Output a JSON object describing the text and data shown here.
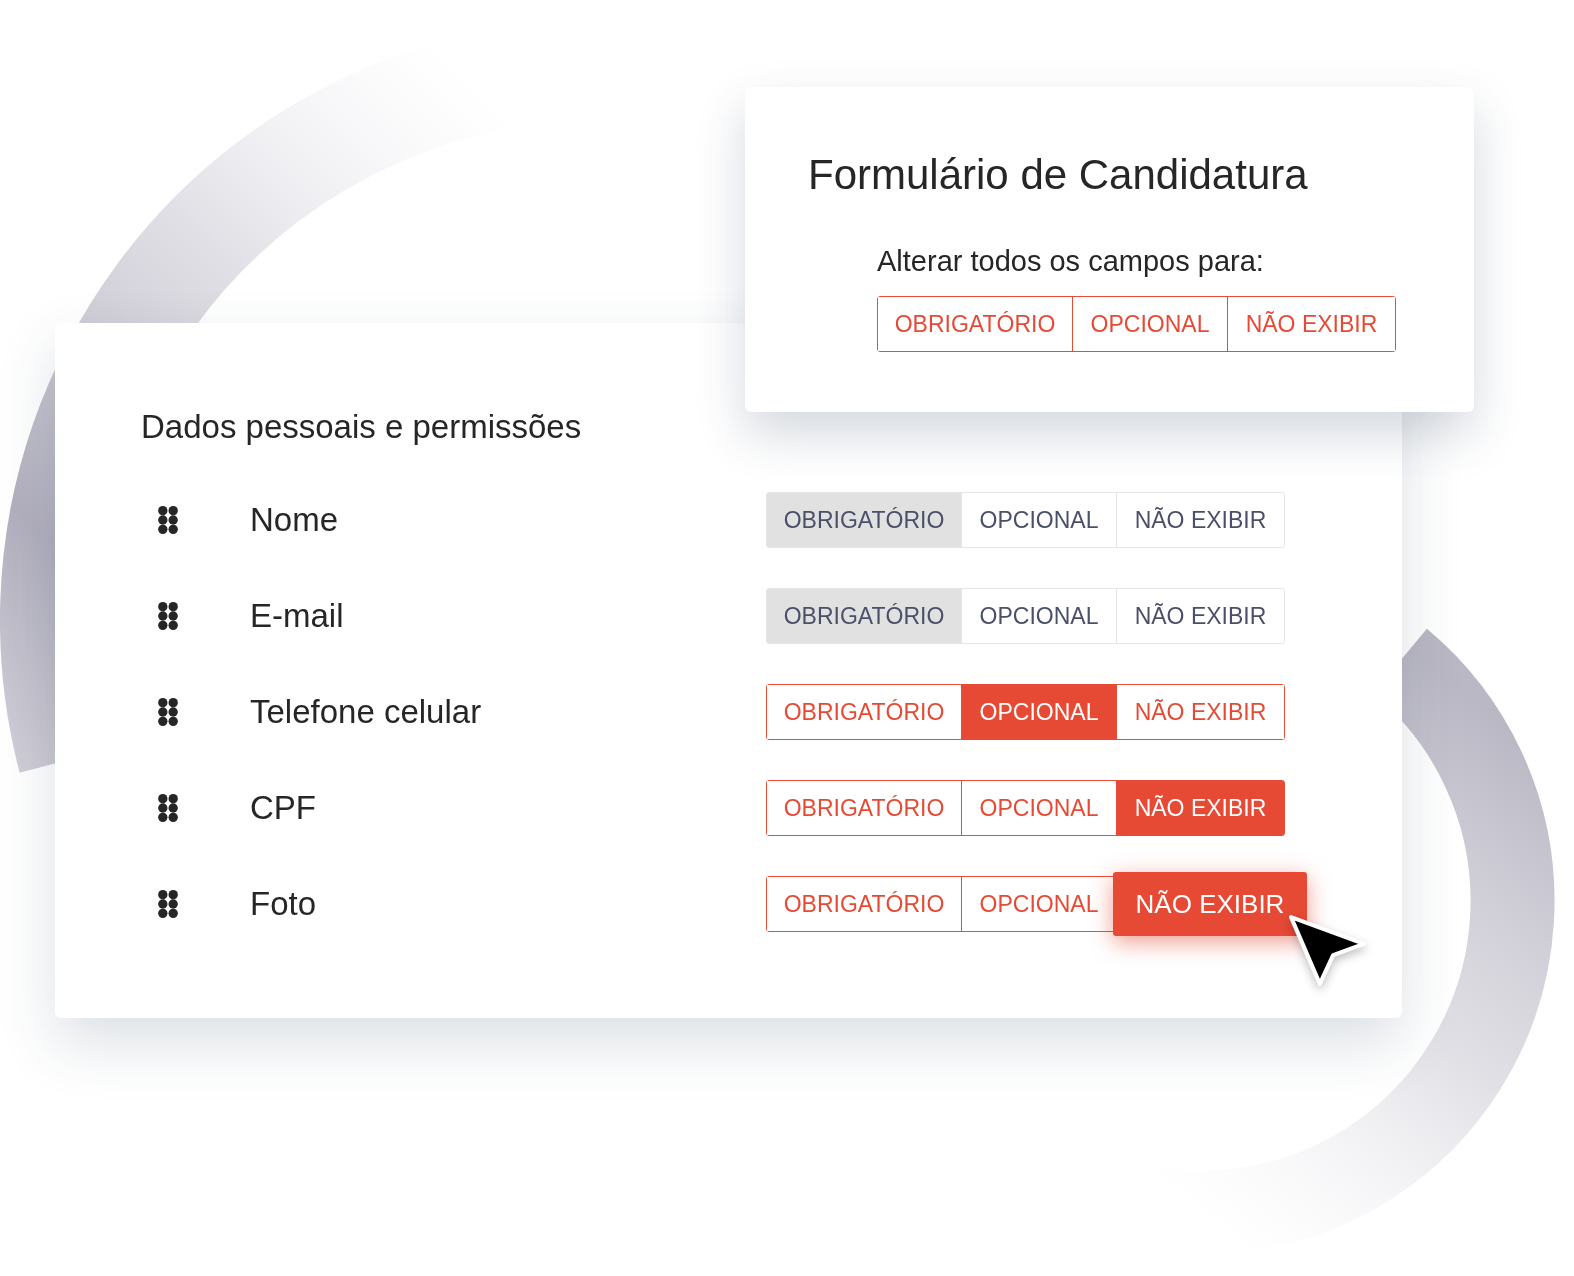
{
  "bulk_card": {
    "title": "Formulário de Candidatura",
    "prompt": "Alterar todos os campos para:",
    "options": [
      {
        "label": "OBRIGATÓRIO",
        "selected": false
      },
      {
        "label": "OPCIONAL",
        "selected": false
      },
      {
        "label": "NÃO EXIBIR",
        "selected": false
      }
    ]
  },
  "section": {
    "title": "Dados pessoais e permissões",
    "fields": [
      {
        "label": "Nome",
        "disabled": true,
        "hovered": false,
        "options": [
          {
            "label": "OBRIGATÓRIO",
            "selected": true
          },
          {
            "label": "OPCIONAL",
            "selected": false
          },
          {
            "label": "NÃO EXIBIR",
            "selected": false
          }
        ]
      },
      {
        "label": "E-mail",
        "disabled": true,
        "hovered": false,
        "options": [
          {
            "label": "OBRIGATÓRIO",
            "selected": true
          },
          {
            "label": "OPCIONAL",
            "selected": false
          },
          {
            "label": "NÃO EXIBIR",
            "selected": false
          }
        ]
      },
      {
        "label": "Telefone celular",
        "disabled": false,
        "hovered": false,
        "options": [
          {
            "label": "OBRIGATÓRIO",
            "selected": false
          },
          {
            "label": "OPCIONAL",
            "selected": true
          },
          {
            "label": "NÃO EXIBIR",
            "selected": false
          }
        ]
      },
      {
        "label": "CPF",
        "disabled": false,
        "hovered": false,
        "options": [
          {
            "label": "OBRIGATÓRIO",
            "selected": false
          },
          {
            "label": "OPCIONAL",
            "selected": false
          },
          {
            "label": "NÃO EXIBIR",
            "selected": true
          }
        ]
      },
      {
        "label": "Foto",
        "disabled": false,
        "hovered": true,
        "options": [
          {
            "label": "OBRIGATÓRIO",
            "selected": false
          },
          {
            "label": "OPCIONAL",
            "selected": false
          },
          {
            "label": "NÃO EXIBIR",
            "selected": true
          }
        ]
      }
    ]
  }
}
